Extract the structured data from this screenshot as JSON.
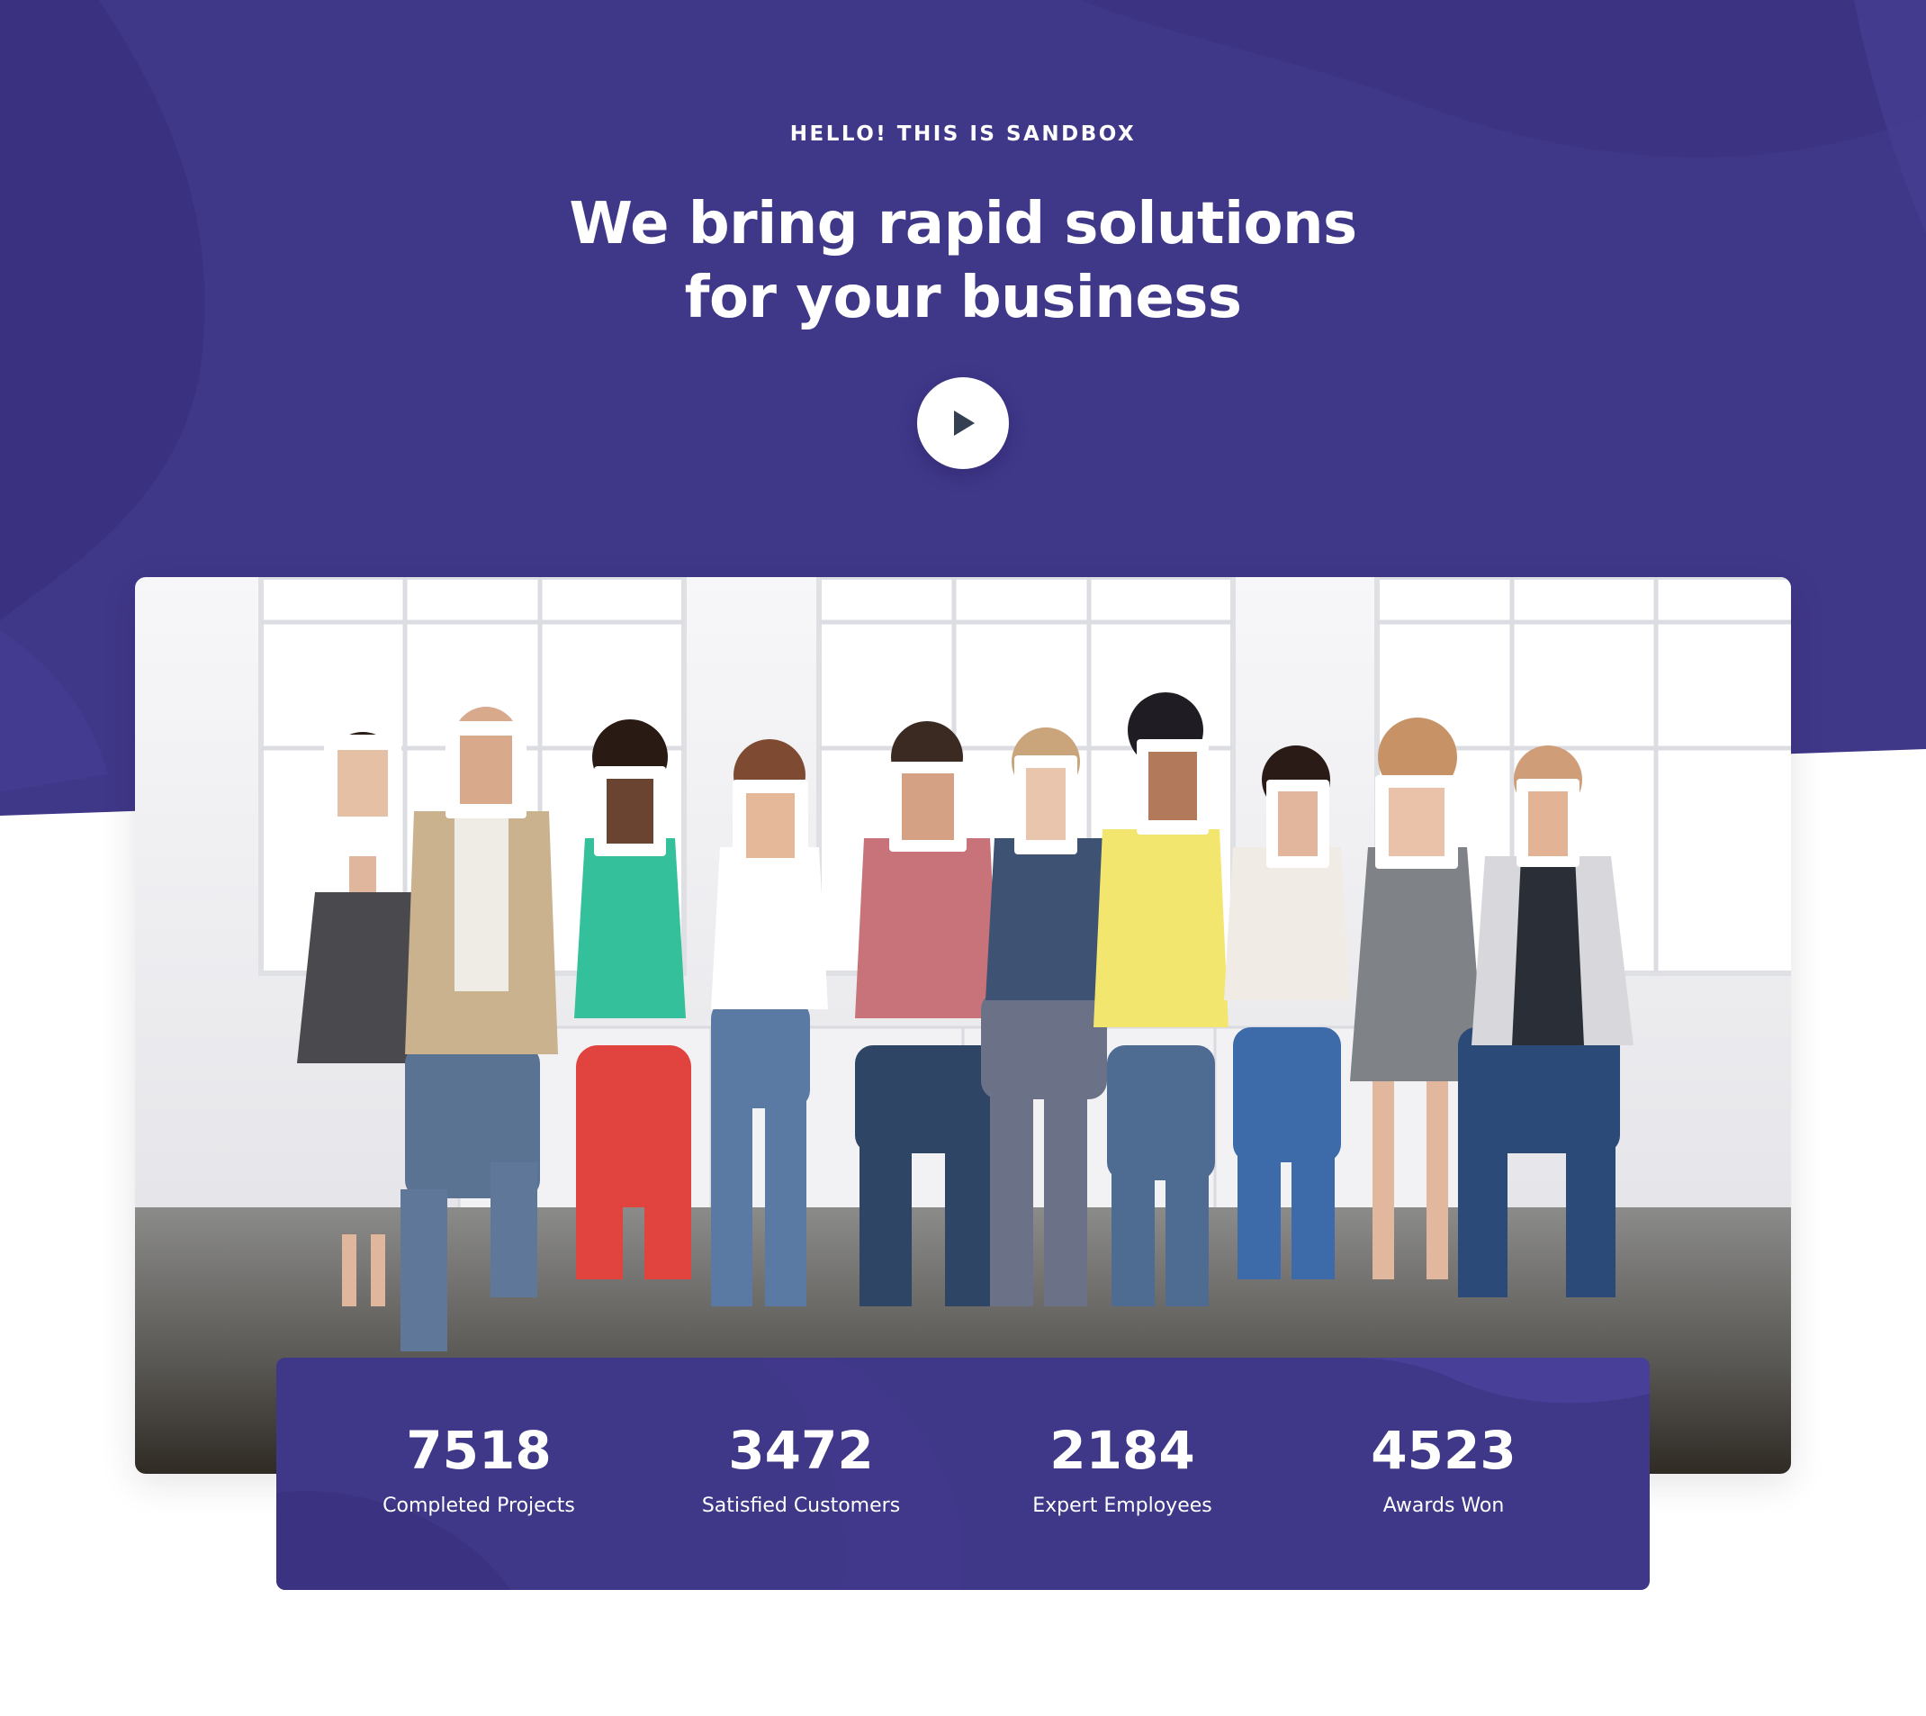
{
  "hero": {
    "eyebrow": "HELLO! THIS IS SANDBOX",
    "headline_line1": "We bring rapid solutions",
    "headline_line2": "for your business",
    "play_icon": "play-icon",
    "background_color": "#3f3788"
  },
  "stats": [
    {
      "value": "7518",
      "label": "Completed Projects"
    },
    {
      "value": "3472",
      "label": "Satisfied Customers"
    },
    {
      "value": "2184",
      "label": "Expert Employees"
    },
    {
      "value": "4523",
      "label": "Awards Won"
    }
  ]
}
